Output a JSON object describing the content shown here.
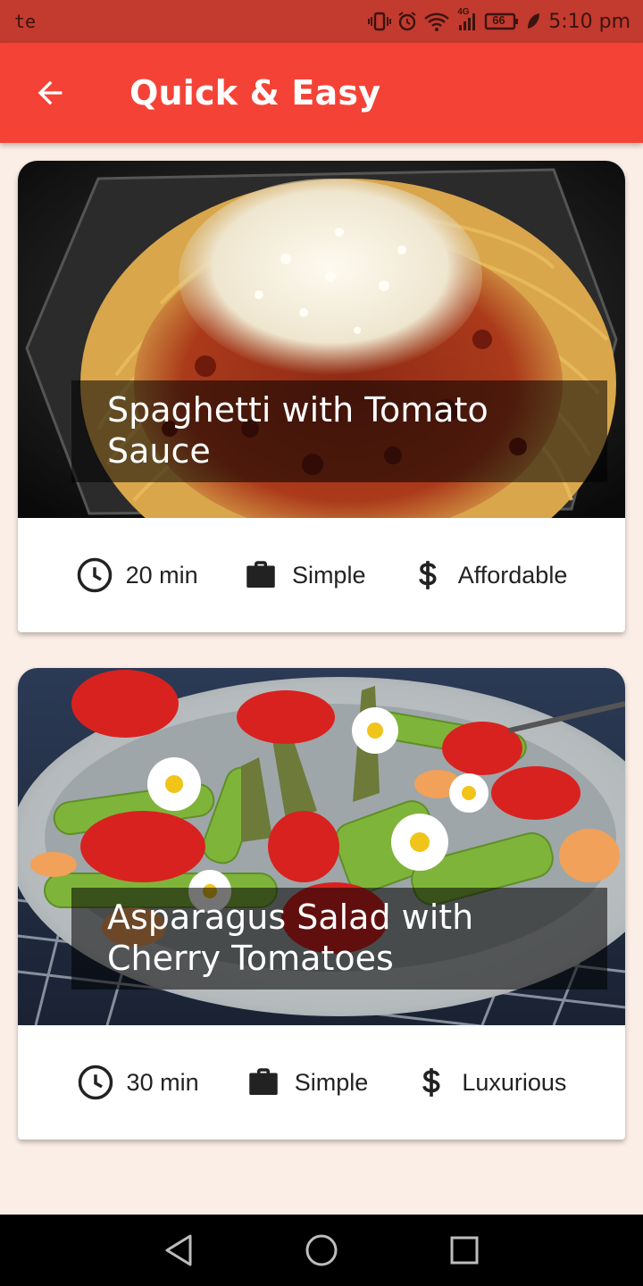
{
  "status_bar": {
    "left_text": "te",
    "time": "5:10 pm",
    "network": "4G",
    "battery": "66",
    "icons": [
      "vibrate-icon",
      "alarm-icon",
      "wifi-icon",
      "signal-icon",
      "battery-icon",
      "leaf-icon"
    ]
  },
  "app_bar": {
    "title": "Quick & Easy",
    "back_icon": "arrow-back-icon",
    "color": "#f44336"
  },
  "meals": [
    {
      "title": "Spaghetti with Tomato Sauce",
      "duration": "20 min",
      "complexity": "Simple",
      "affordability": "Affordable"
    },
    {
      "title": "Asparagus Salad with Cherry Tomatoes",
      "duration": "30 min",
      "complexity": "Simple",
      "affordability": "Luxurious"
    }
  ],
  "nav_bar": {
    "buttons": [
      "back-triangle-icon",
      "home-circle-icon",
      "recents-square-icon"
    ]
  },
  "colors": {
    "accent": "#f44336",
    "status_bar": "#c33a2f",
    "background": "#fbeee6"
  }
}
